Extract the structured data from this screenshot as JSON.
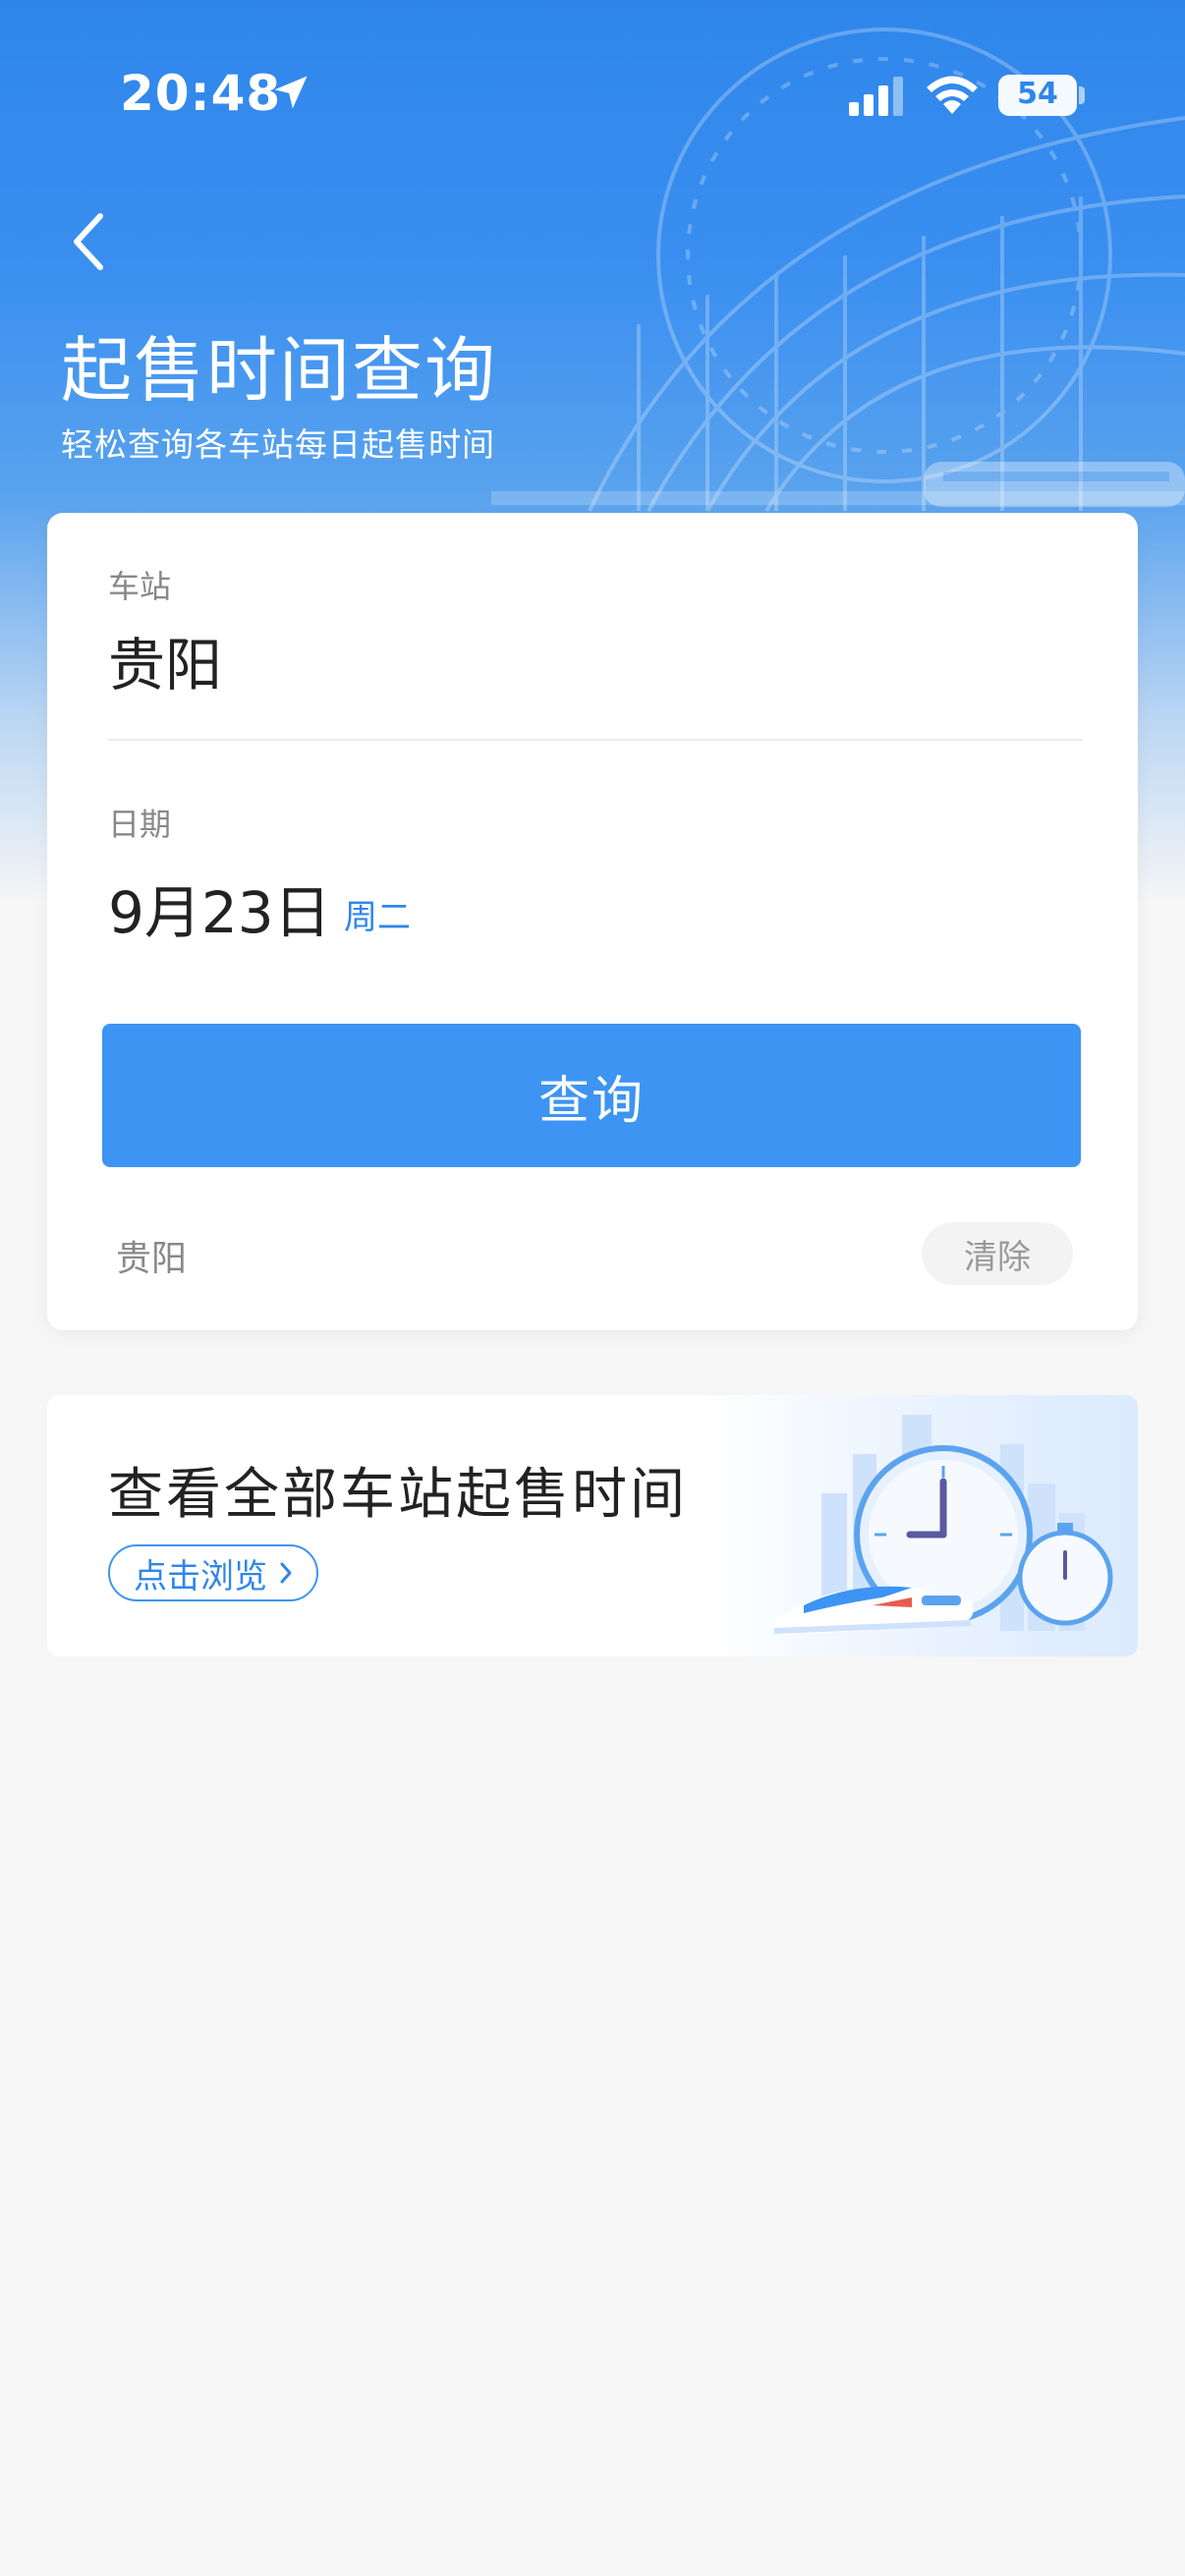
{
  "status_bar": {
    "time": "20:48",
    "battery": "54"
  },
  "header": {
    "title": "起售时间查询",
    "subtitle": "轻松查询各车站每日起售时间"
  },
  "form": {
    "station_label": "车站",
    "station_value": "贵阳",
    "date_label": "日期",
    "date_value": "9月23日",
    "weekday": "周二",
    "query_button": "查询"
  },
  "history": {
    "items": [
      "贵阳"
    ],
    "clear_label": "清除"
  },
  "banner": {
    "title": "查看全部车站起售时间",
    "browse_label": "点击浏览"
  },
  "colors": {
    "primary": "#3d94f3",
    "accent_text": "#2f86ea",
    "page_bg": "#f6f6f6"
  }
}
